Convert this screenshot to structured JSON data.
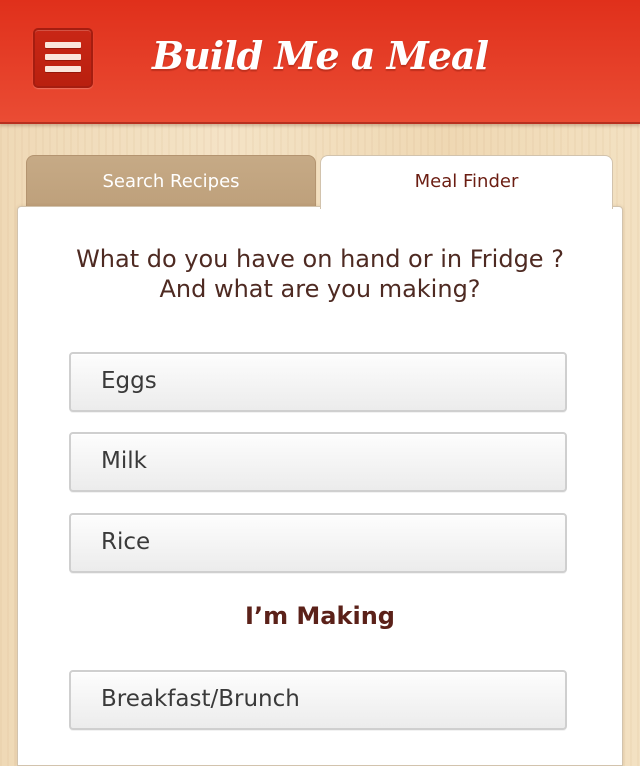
{
  "header": {
    "title": "Build Me a Meal",
    "menu_icon": "hamburger-menu-icon"
  },
  "tabs": [
    {
      "label": "Search Recipes",
      "active": false
    },
    {
      "label": "Meal Finder",
      "active": true
    }
  ],
  "finder": {
    "question_line1": "What do you have on hand or in Fridge ?",
    "question_line2": "And what are you making?",
    "ingredients": [
      "Eggs",
      "Milk",
      "Rice"
    ],
    "making_label": "I’m Making",
    "meal_type": "Breakfast/Brunch"
  },
  "colors": {
    "header_red": "#e0301b",
    "tab_inactive": "#c6aa86",
    "text_brown": "#4e2a22",
    "wood_background": "#f1dcba"
  }
}
